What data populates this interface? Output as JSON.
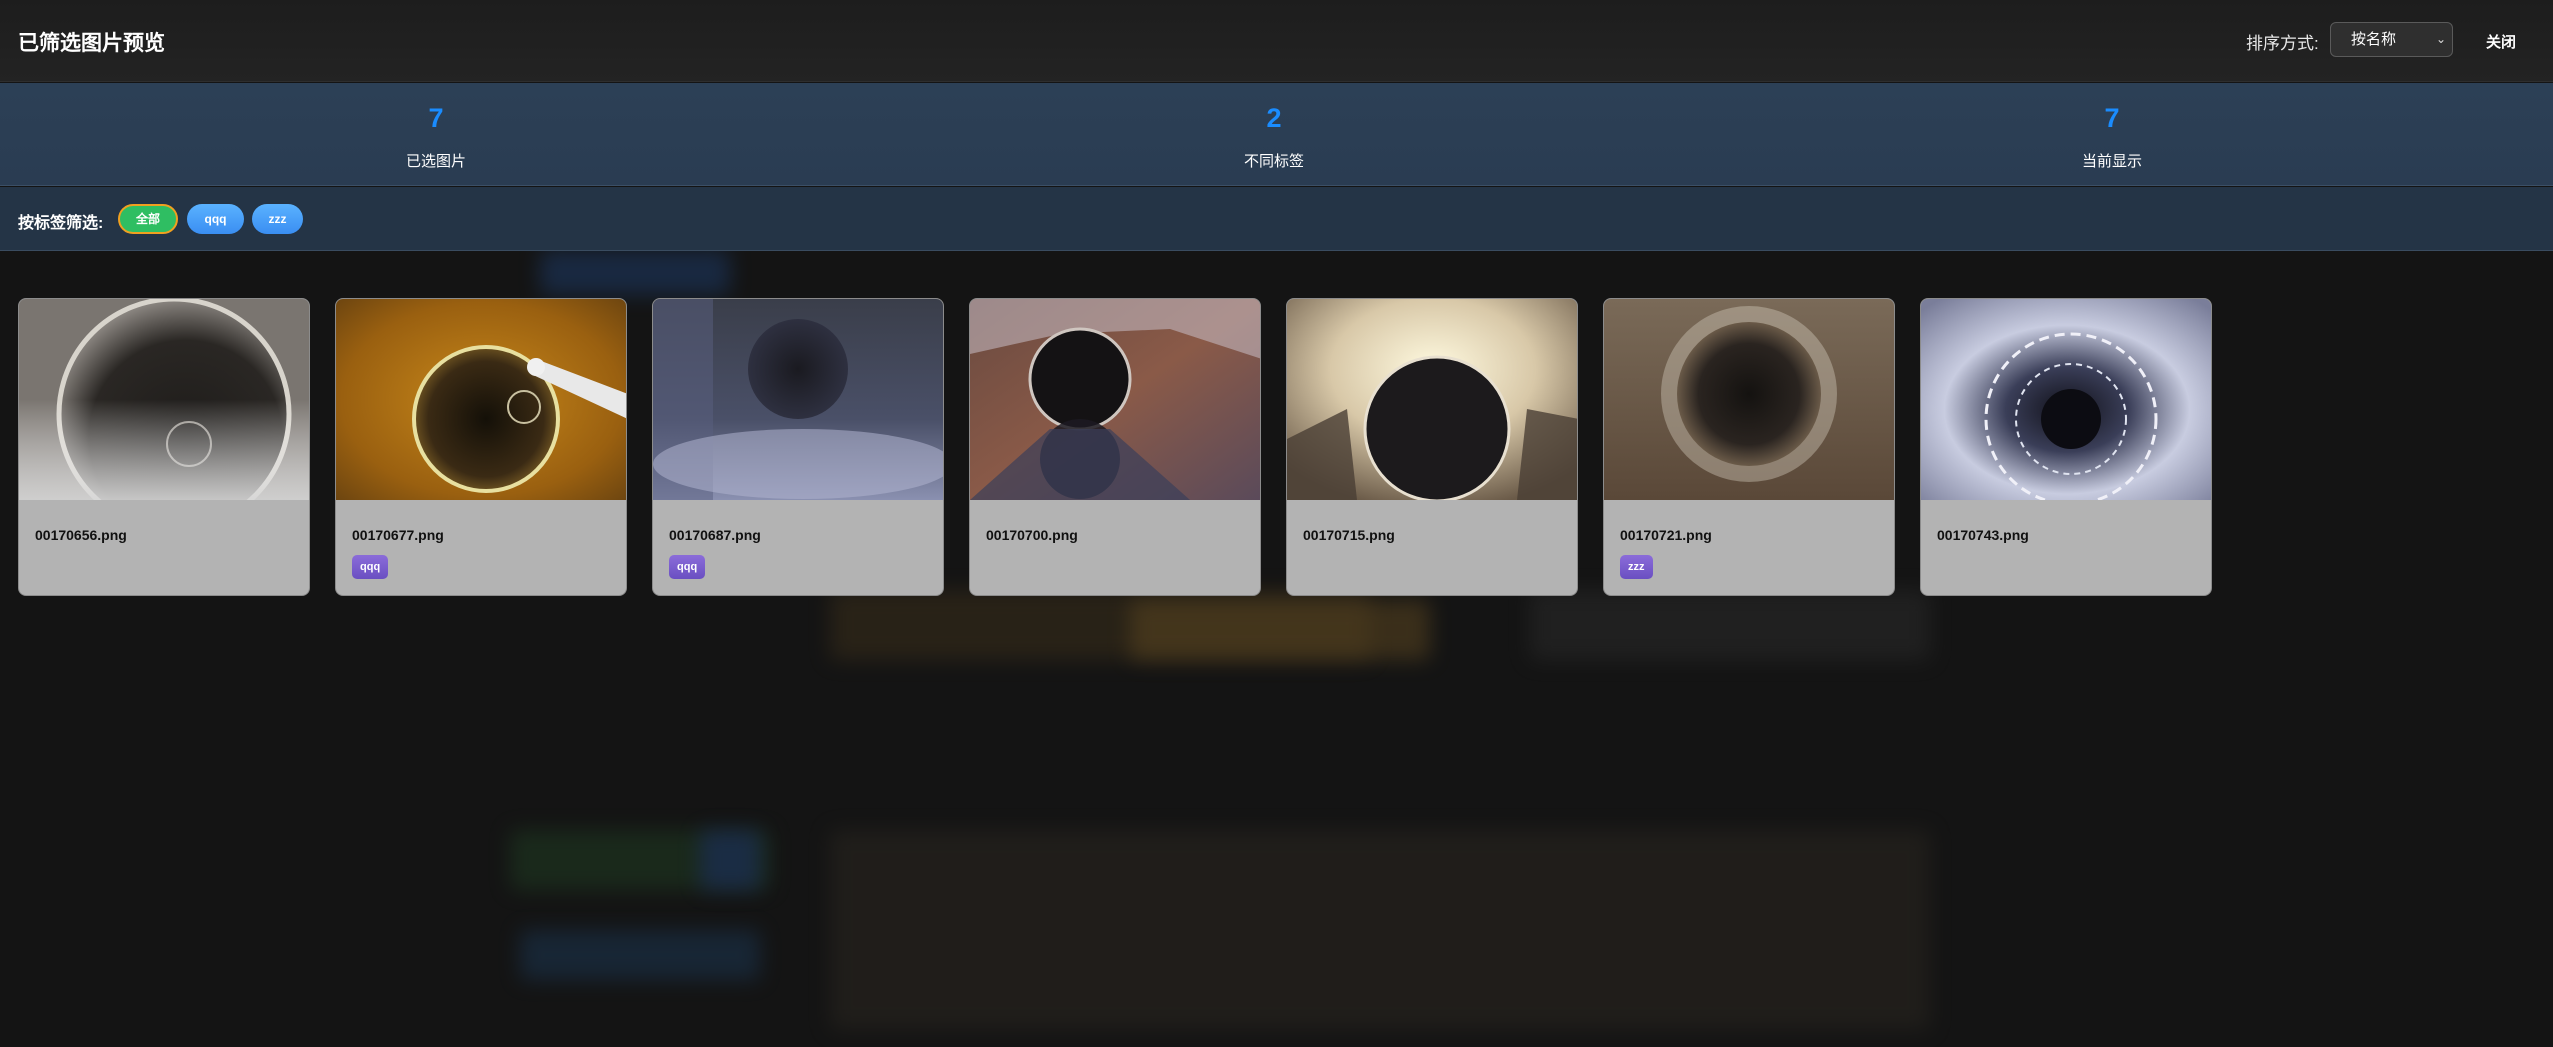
{
  "header": {
    "title": "已筛选图片预览",
    "sort_label": "排序方式:",
    "sort_selected": "按名称",
    "close_label": "关闭"
  },
  "stats": [
    {
      "value": "7",
      "label": "已选图片"
    },
    {
      "value": "2",
      "label": "不同标签"
    },
    {
      "value": "7",
      "label": "当前显示"
    }
  ],
  "filter": {
    "label": "按标签筛选:",
    "chips": [
      {
        "label": "全部",
        "active": true
      },
      {
        "label": "qqq",
        "active": false
      },
      {
        "label": "zzz",
        "active": false
      }
    ]
  },
  "cards": [
    {
      "filename": "00170656.png",
      "tag": ""
    },
    {
      "filename": "00170677.png",
      "tag": "qqq"
    },
    {
      "filename": "00170687.png",
      "tag": "qqq"
    },
    {
      "filename": "00170700.png",
      "tag": ""
    },
    {
      "filename": "00170715.png",
      "tag": ""
    },
    {
      "filename": "00170721.png",
      "tag": "zzz"
    },
    {
      "filename": "00170743.png",
      "tag": ""
    }
  ],
  "colors": {
    "accent_number": "#1a8cff",
    "chip_active": "#2fbe62",
    "chip_active_border": "#f0a020",
    "chip_normal": "#3a8ef2",
    "tag_purple": "#6a4fc2",
    "stats_bg": "#2c4056",
    "header_bg": "#1f1f1f"
  },
  "icons": {
    "sort_dropdown": "chevron-down-icon"
  }
}
